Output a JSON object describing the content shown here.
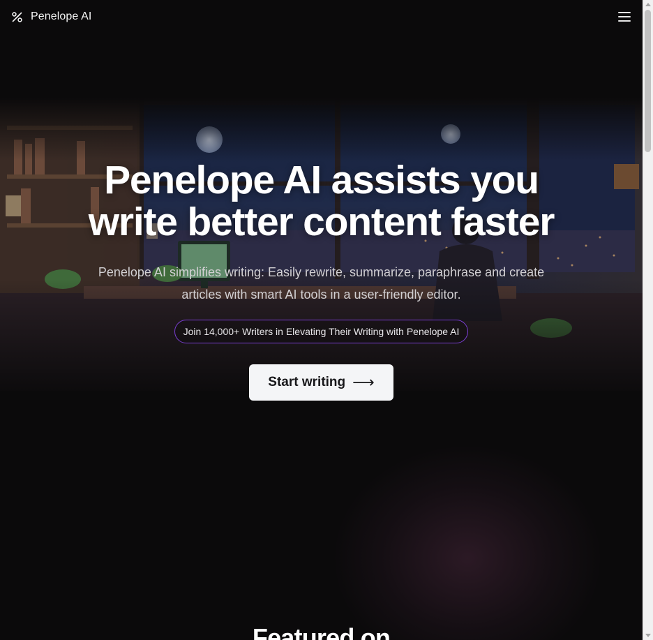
{
  "header": {
    "brand_name": "Penelope AI",
    "brand_icon": "percent-logo-icon",
    "menu_icon": "hamburger-menu-icon"
  },
  "hero": {
    "title": "Penelope AI assists you write better content faster",
    "subtitle": "Penelope AI simplifies writing: Easily rewrite, summarize, paraphrase and create articles with smart AI tools in a user-friendly editor.",
    "badge": "Join 14,000+ Writers in Elevating Their Writing with Penelope AI",
    "cta_label": "Start writing",
    "cta_icon": "arrow-right-icon",
    "background_image": "lofi-desk-night-scene"
  },
  "featured": {
    "heading": "Featured on"
  },
  "colors": {
    "background": "#0b0a0b",
    "badge_border": "#7b3fd4",
    "cta_background": "#f4f5f7",
    "cta_text": "#17171a"
  }
}
